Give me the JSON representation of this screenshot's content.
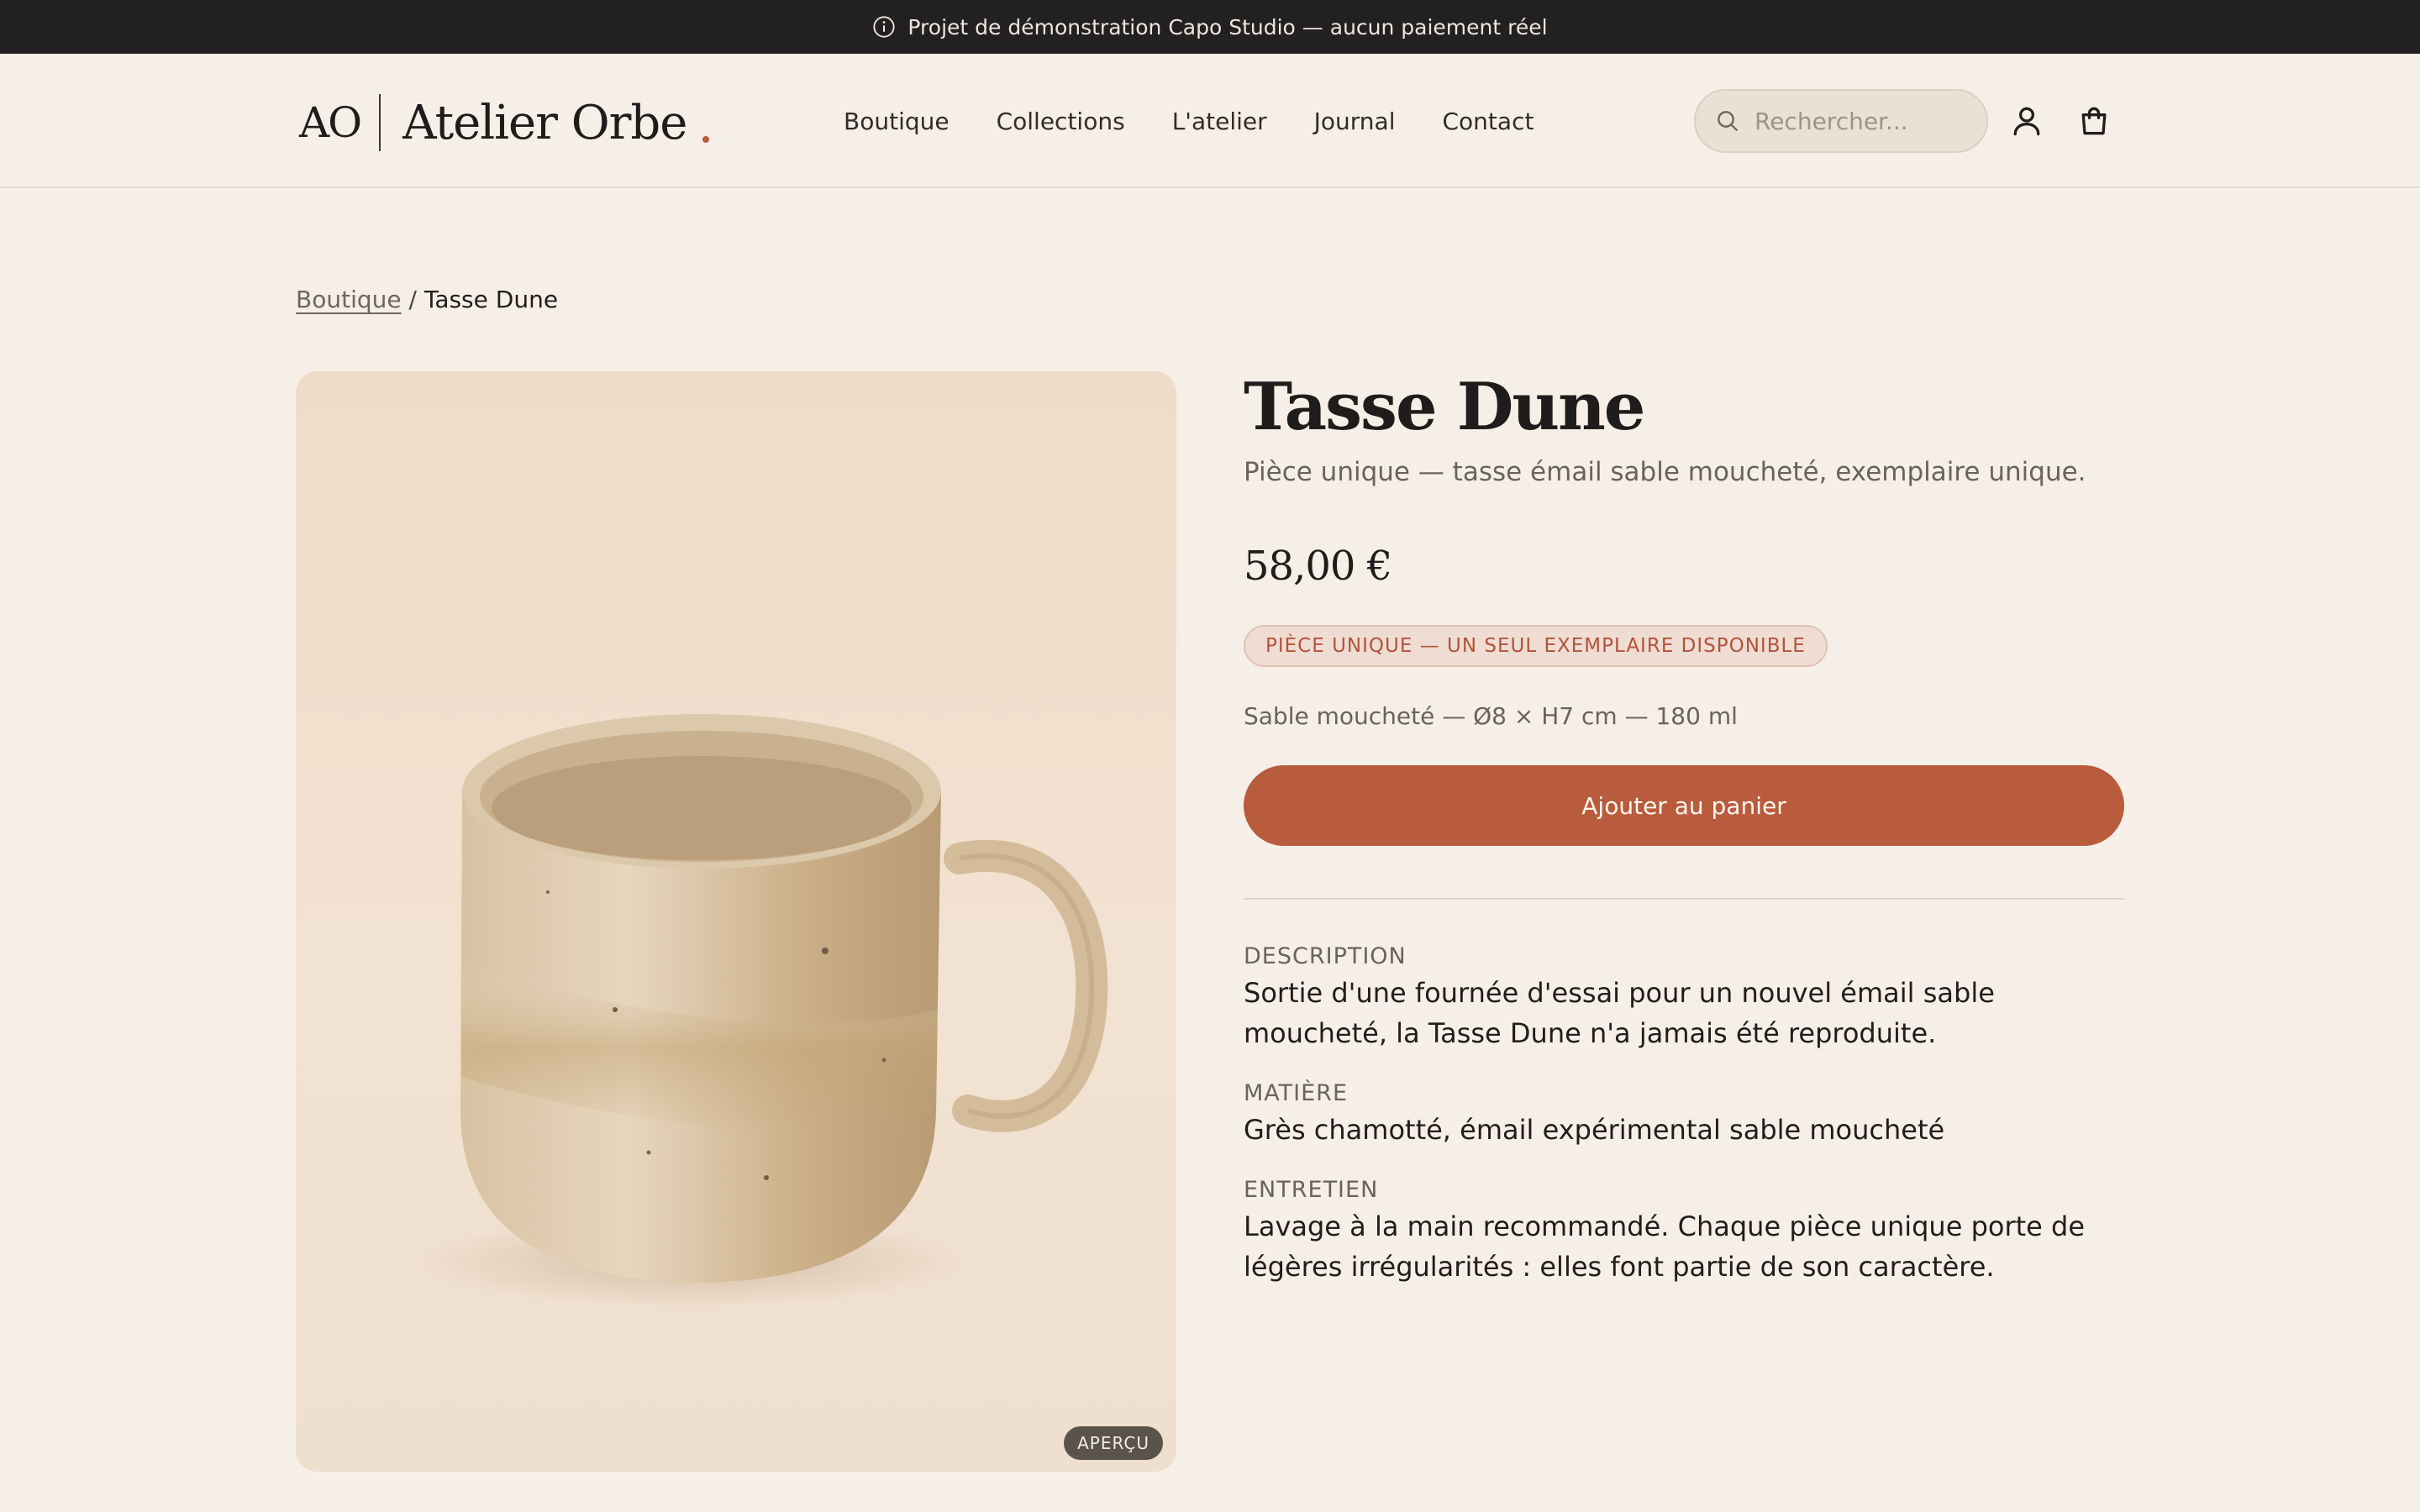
{
  "topbar": {
    "message": "Projet de démonstration Capo Studio — aucun paiement réel",
    "icon": "info-icon"
  },
  "header": {
    "logo_mark": "AO",
    "logo_name": "Atelier Orbe",
    "nav": [
      "Boutique",
      "Collections",
      "L'atelier",
      "Journal",
      "Contact"
    ],
    "search_placeholder": "Rechercher...",
    "icons": [
      "search-icon",
      "user-icon",
      "shopping-bag-icon"
    ]
  },
  "breadcrumb": {
    "parent": "Boutique",
    "separator": "/",
    "current": "Tasse Dune"
  },
  "product": {
    "title": "Tasse Dune",
    "subtitle": "Pièce unique — tasse émail sable moucheté, exemplaire unique.",
    "price": "58,00 €",
    "tag": "PIÈCE UNIQUE — UN SEUL EXEMPLAIRE DISPONIBLE",
    "specs": "Sable moucheté — Ø8 × H7 cm — 180 ml",
    "add_to_cart": "Ajouter au panier",
    "image_badge": "APERÇU",
    "sections": [
      {
        "heading": "DESCRIPTION",
        "body": "Sortie d'une fournée d'essai pour un nouvel émail sable moucheté, la Tasse Dune n'a jamais été reproduite."
      },
      {
        "heading": "MATIÈRE",
        "body": "Grès chamotté, émail expérimental sable moucheté"
      },
      {
        "heading": "ENTRETIEN",
        "body": "Lavage à la main recommandé. Chaque pièce unique porte de légères irrégularités : elles font partie de son caractère."
      }
    ]
  },
  "colors": {
    "accent": "#b85c3d",
    "background": "#f6efe7",
    "topbar": "#222020"
  }
}
